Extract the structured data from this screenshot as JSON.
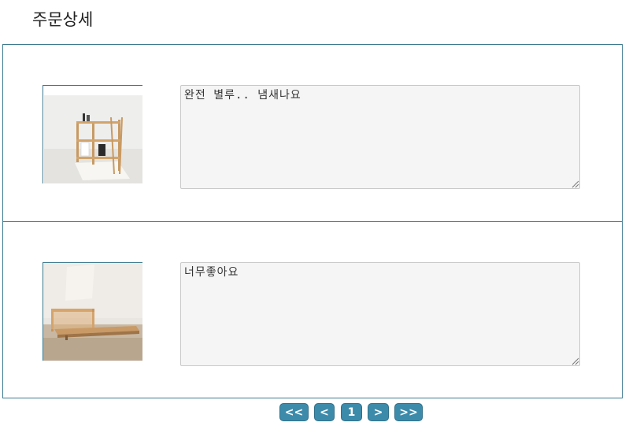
{
  "page": {
    "title": "주문상세"
  },
  "orders": [
    {
      "thumbnail_icon": "shelf-product-image",
      "review_text": "완전 별루.. 냄새나요"
    },
    {
      "thumbnail_icon": "bed-product-image",
      "review_text": "너무좋아요"
    }
  ],
  "pagination": {
    "first_label": "<<",
    "prev_label": "<",
    "current_page": "1",
    "next_label": ">",
    "last_label": ">>"
  },
  "colors": {
    "border": "#3d7a8f",
    "button": "#3d8bab",
    "textarea_bg": "#f5f5f5"
  }
}
